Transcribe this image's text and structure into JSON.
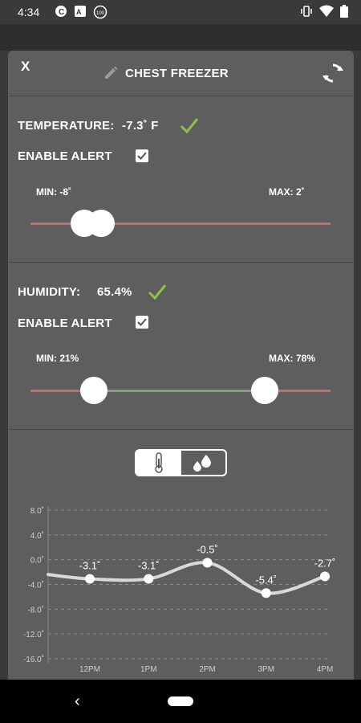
{
  "status_bar": {
    "time": "4:34",
    "left_icons": [
      "app-badge-icon",
      "translate-icon",
      "circle-badge-icon"
    ],
    "right_icons": [
      "vibrate-icon",
      "wifi-icon",
      "battery-icon"
    ]
  },
  "header": {
    "close_label": "X",
    "title": "CHEST FREEZER",
    "edit_icon": "pencil-icon",
    "refresh_icon": "refresh-icon"
  },
  "temperature": {
    "label": "TEMPERATURE:",
    "value": "-7.3˚ F",
    "status_icon": "check-icon",
    "alert_label": "ENABLE ALERT",
    "alert_enabled": true,
    "min_label": "MIN: -8˚",
    "max_label": "MAX: 2˚"
  },
  "humidity": {
    "label": "HUMIDITY:",
    "value": "65.4%",
    "status_icon": "check-icon",
    "alert_label": "ENABLE ALERT",
    "alert_enabled": true,
    "min_label": "MIN: 21%",
    "max_label": "MAX: 78%"
  },
  "chart_toggle": {
    "options": [
      "thermometer-icon",
      "humidity-drops-icon"
    ],
    "selected": "thermometer-icon"
  },
  "colors": {
    "check": "#8bc34a",
    "track_red": "#c96a6a",
    "track_green": "#7fa47a",
    "line": "#d9d9d9"
  },
  "chart_data": {
    "type": "line",
    "x": [
      "12PM",
      "1PM",
      "2PM",
      "3PM",
      "4PM"
    ],
    "series": [
      {
        "values": [
          -3.1,
          -3.1,
          -0.5,
          -5.4,
          -2.7
        ],
        "labels": [
          "-3.1˚",
          "-3.1˚",
          "-0.5˚",
          "-5.4˚",
          "-2.7˚"
        ]
      }
    ],
    "ylim": [
      -16,
      8
    ],
    "yticks": [
      "8.0˚",
      "4.0˚",
      "0.0˚",
      "-4.0˚",
      "-8.0˚",
      "-12.0˚",
      "-16.0˚"
    ],
    "ytick_values": [
      8,
      4,
      0,
      -4,
      -8,
      -12,
      -16
    ],
    "grid": true
  },
  "navbar": {
    "back_label": "‹"
  }
}
